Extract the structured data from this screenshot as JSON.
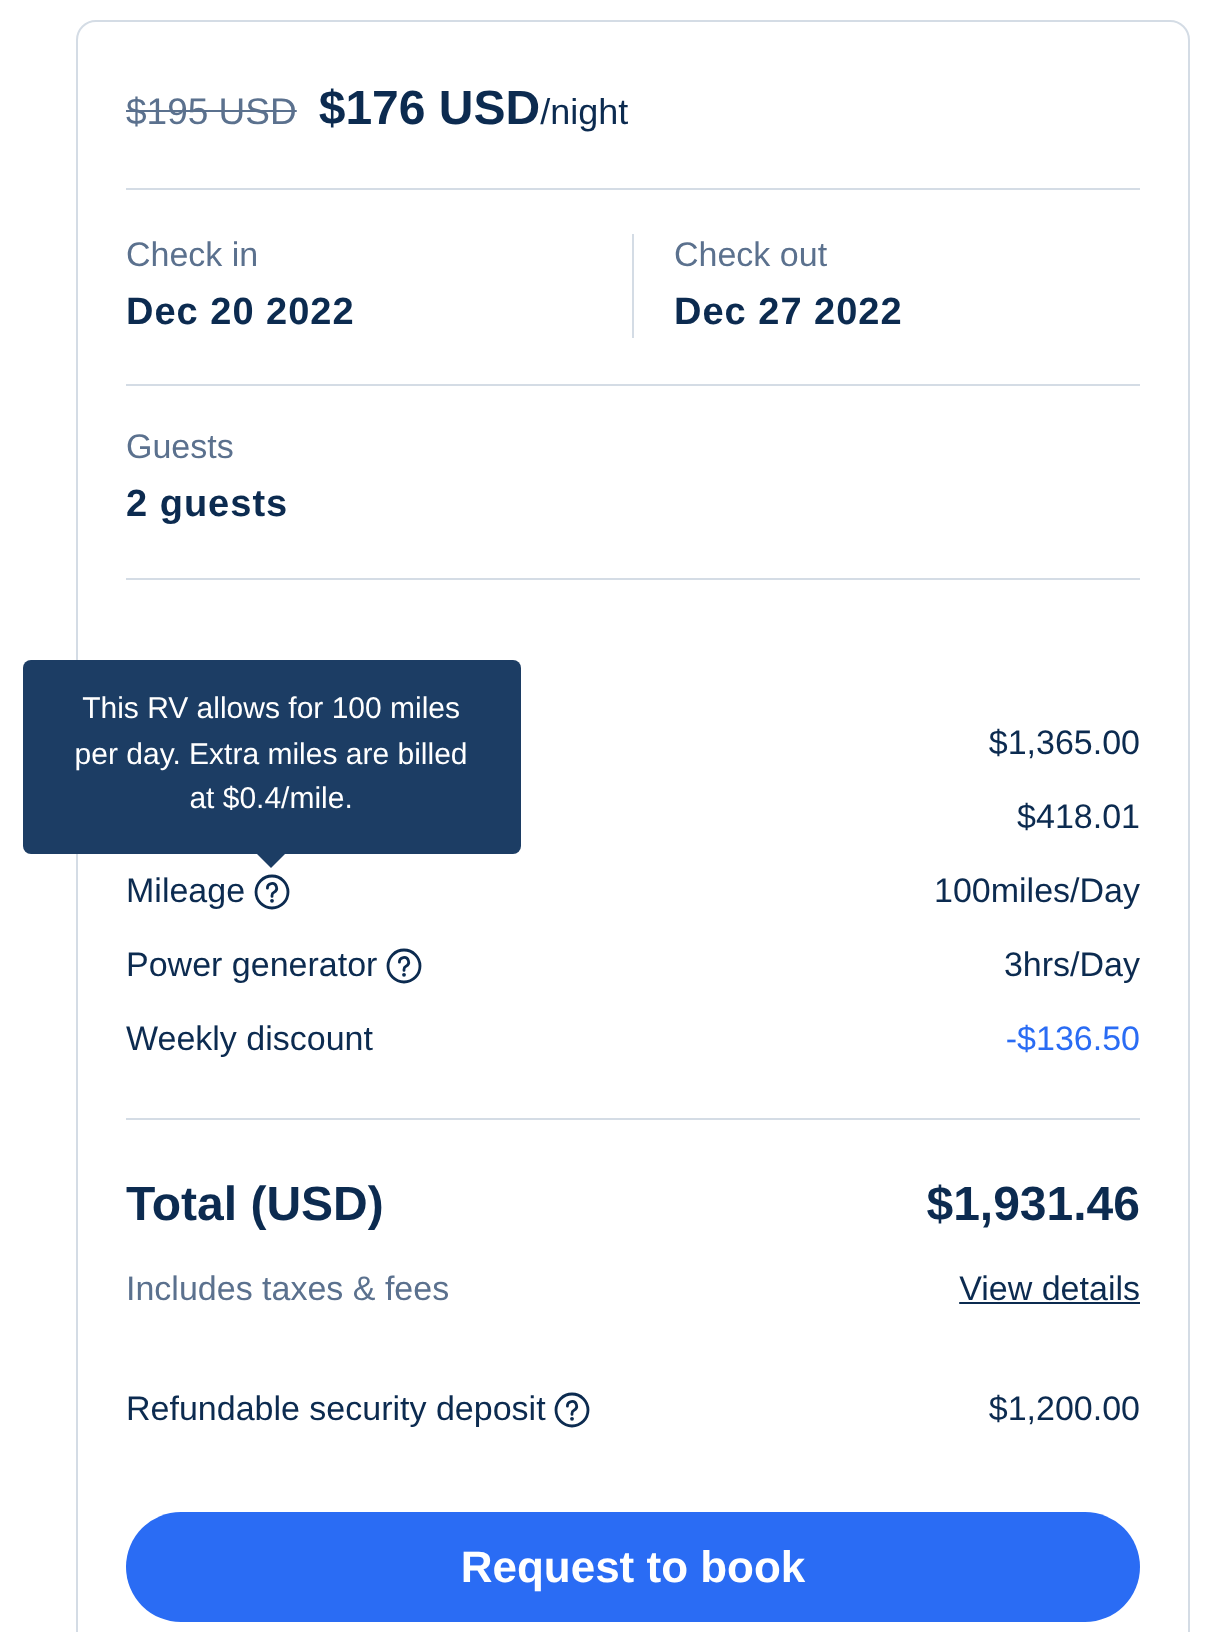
{
  "price": {
    "was": "$195 USD",
    "amount": "$176 USD",
    "unit": "/night"
  },
  "dates": [
    {
      "label": "Check in",
      "value": "Dec 20 2022"
    },
    {
      "label": "Check out",
      "value": "Dec 27 2022"
    }
  ],
  "guests": {
    "label": "Guests",
    "value": "2 guests"
  },
  "price_details": {
    "rows": [
      {
        "value": "$1,365.00",
        "kind": "charge",
        "help_icon": false
      },
      {
        "value": "$418.01",
        "kind": "charge",
        "help_icon": false
      },
      {
        "label": "Mileage",
        "value": "100miles/Day",
        "kind": "charge",
        "help_icon": true,
        "tooltip": "This RV allows for 100 miles per day. Extra miles are billed at $0.4/mile."
      },
      {
        "label": "Power generator",
        "value": "3hrs/Day",
        "kind": "charge",
        "help_icon": true
      },
      {
        "label": "Weekly discount",
        "value": "-$136.50",
        "kind": "discount",
        "help_icon": false
      }
    ]
  },
  "total": {
    "label": "Total (USD)",
    "value": "$1,931.46",
    "note": "Includes taxes & fees",
    "link": "View details"
  },
  "deposit": {
    "label": "Refundable security deposit",
    "value": "$1,200.00",
    "help_icon": true
  },
  "button": "Request to book"
}
